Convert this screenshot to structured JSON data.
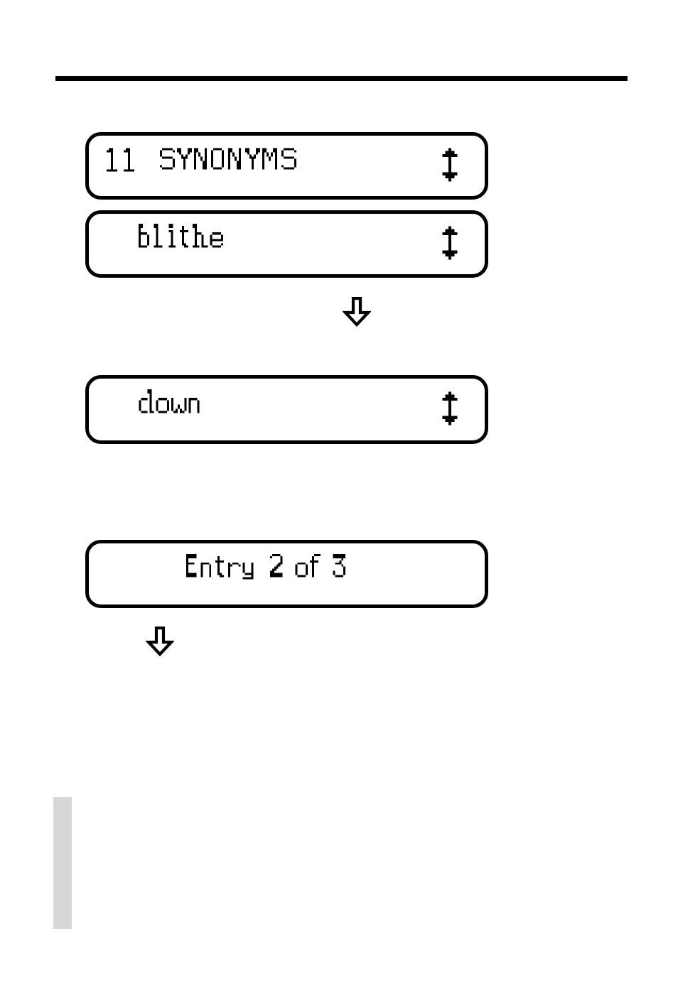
{
  "page": {
    "kind": "manual-illustration",
    "background_color": "#ffffff",
    "ink_color": "#000000"
  },
  "rule": {
    "name": "top-horizontal-rule",
    "color": "#000000"
  },
  "margin_bar": {
    "name": "left-margin-tab",
    "color": "#d7d7d7"
  },
  "screens": [
    {
      "id": "screen-synonym-count",
      "text": "11 SYNONYMS",
      "indicator": "up-down-arrow",
      "has_indicator": true
    },
    {
      "id": "screen-headword",
      "text": "blithe",
      "indicator": "up-down-arrow",
      "has_indicator": true
    },
    {
      "id": "screen-synonym-down",
      "text": "down",
      "indicator": "up-down-arrow",
      "has_indicator": true
    },
    {
      "id": "screen-entry-counter",
      "text": "Entry 2 of 3",
      "indicator": "",
      "has_indicator": false
    }
  ],
  "flow_arrows": [
    {
      "id": "flow-arrow-after-headword",
      "glyph": "down-arrow-outline"
    },
    {
      "id": "flow-arrow-after-entry-counter",
      "glyph": "down-arrow-outline"
    }
  ],
  "alt_text": {
    "screen_1": "11 SYNONYMS",
    "screen_2": "blithe",
    "screen_3": "down",
    "screen_4": "Entry 2 of 3"
  }
}
